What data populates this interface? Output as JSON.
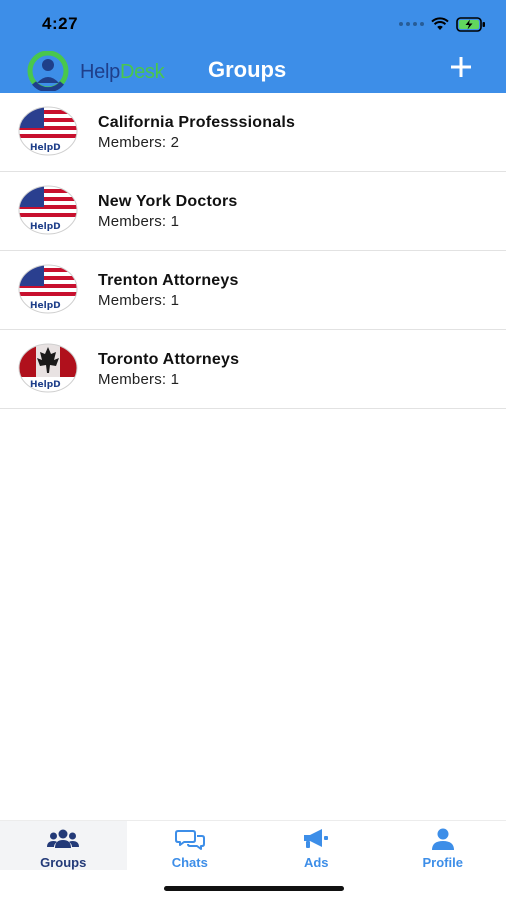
{
  "status_bar": {
    "time": "4:27"
  },
  "nav": {
    "logo_help": "Help",
    "logo_desk": "Desk",
    "title": "Groups",
    "add_icon": "plus-icon"
  },
  "groups": [
    {
      "name": "California Professsionals",
      "members": "Members: 2",
      "avatar": "us-flag-helpdesk-avatar"
    },
    {
      "name": "New York Doctors",
      "members": "Members: 1",
      "avatar": "us-flag-helpdesk-avatar"
    },
    {
      "name": "Trenton Attorneys",
      "members": "Members: 1",
      "avatar": "us-flag-helpdesk-avatar"
    },
    {
      "name": "Toronto Attorneys",
      "members": "Members: 1",
      "avatar": "canada-flag-helpdesk-avatar"
    }
  ],
  "avatar_text": "HelpD",
  "tabs": [
    {
      "label": "Groups",
      "icon": "users-icon",
      "active": true
    },
    {
      "label": "Chats",
      "icon": "chat-bubbles-icon",
      "active": false
    },
    {
      "label": "Ads",
      "icon": "megaphone-icon",
      "active": false
    },
    {
      "label": "Profile",
      "icon": "person-icon",
      "active": false
    }
  ],
  "colors": {
    "header_bg": "#3d8ee8",
    "tab_active": "#233a78",
    "tab_inactive": "#3d8ee8",
    "logo_help": "#1f3f8a",
    "logo_desk": "#49c74d"
  }
}
